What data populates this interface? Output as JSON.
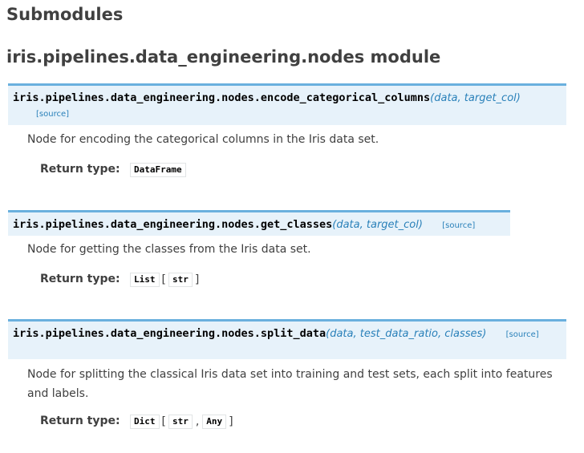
{
  "headings": {
    "submodules": "Submodules",
    "module": "iris.pipelines.data_engineering.nodes module"
  },
  "functions": [
    {
      "name": "iris.pipelines.data_engineering.nodes.encode_categorical_columns",
      "params": "(data, target_col)",
      "source": "[source]",
      "description": "Node for encoding the categorical columns in the Iris data set.",
      "return_label": "Return type:",
      "return_type": "DataFrame"
    },
    {
      "name": "iris.pipelines.data_engineering.nodes.get_classes",
      "params": "(data, target_col)",
      "source": "[source]",
      "description": "Node for getting the classes from the Iris data set.",
      "return_label": "Return type:",
      "return_type": "List",
      "return_args": [
        "str"
      ]
    },
    {
      "name": "iris.pipelines.data_engineering.nodes.split_data",
      "params": "(data, test_data_ratio, classes)",
      "source": "[source]",
      "description_line1": "Node for splitting the classical Iris data set into training and test sets, each split into features",
      "description_line2": "and labels.",
      "return_label": "Return type:",
      "return_type": "Dict",
      "return_args": [
        "str",
        "Any"
      ],
      "separator": ","
    }
  ],
  "brackets": {
    "open": "[",
    "close": "]"
  }
}
